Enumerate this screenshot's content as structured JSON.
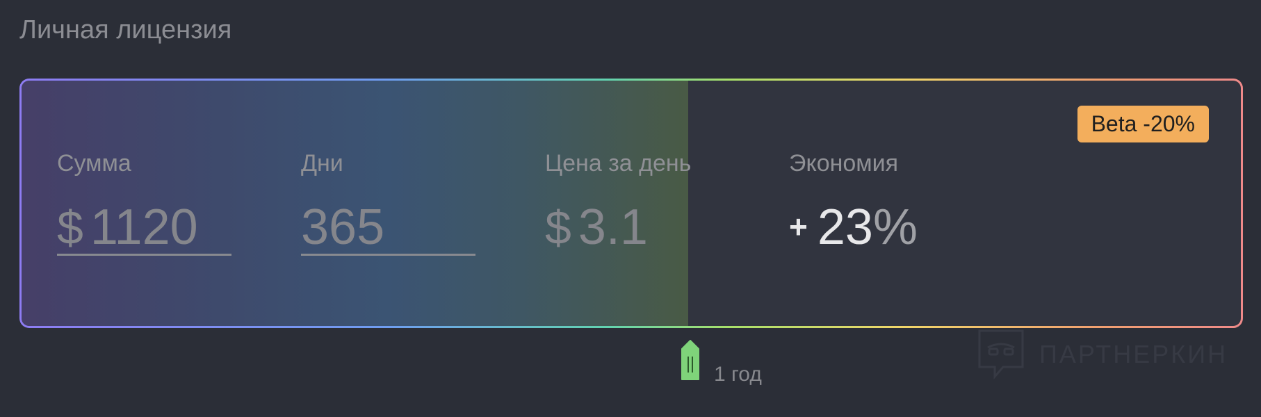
{
  "page": {
    "title": "Личная лицензия"
  },
  "license": {
    "badge": "Beta -20%",
    "fields": {
      "sum": {
        "label": "Сумма",
        "currency": "$",
        "value": "1120"
      },
      "days": {
        "label": "Дни",
        "value": "365"
      },
      "price_per_day": {
        "label": "Цена за день",
        "currency": "$",
        "value": "3.1"
      },
      "savings": {
        "label": "Экономия",
        "sign": "+",
        "value": "23",
        "unit": "%"
      }
    }
  },
  "slider": {
    "label": "1 год",
    "fraction": 0.547
  },
  "watermark": {
    "text": "ПАРТНЕРКИН",
    "icon": "chat-mask-icon"
  },
  "colors": {
    "badge": "#f3ae5c",
    "handle": "#7fd37a",
    "background": "#2b2e37"
  }
}
